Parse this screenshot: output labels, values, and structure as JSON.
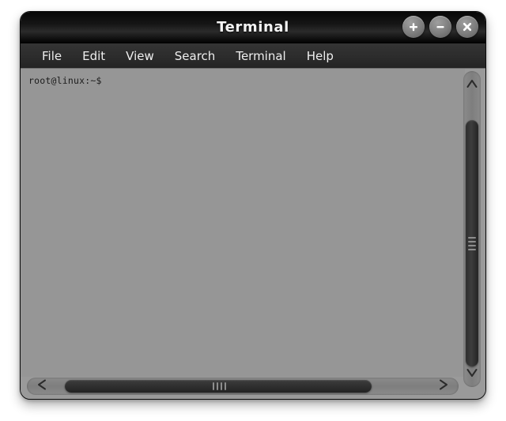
{
  "window": {
    "title": "Terminal",
    "controls": [
      {
        "name": "maximize-button",
        "icon": "plus-icon",
        "label": "+"
      },
      {
        "name": "minimize-button",
        "icon": "minus-icon",
        "label": "−"
      },
      {
        "name": "close-button",
        "icon": "close-icon",
        "label": "×"
      }
    ]
  },
  "menubar": {
    "items": [
      {
        "label": "File"
      },
      {
        "label": "Edit"
      },
      {
        "label": "View"
      },
      {
        "label": "Search"
      },
      {
        "label": "Terminal"
      },
      {
        "label": "Help"
      }
    ]
  },
  "terminal": {
    "prompt": "root@linux:~$",
    "lines": [
      "root@linux:~$"
    ],
    "background_color": "#969696",
    "text_color": "#1c1c1c"
  },
  "scrollbars": {
    "vertical": {
      "up_arrow_icon": "chevron-up-icon",
      "down_arrow_icon": "chevron-down-icon",
      "grip_line_count": 4
    },
    "horizontal": {
      "left_arrow_icon": "chevron-left-icon",
      "right_arrow_icon": "chevron-right-icon",
      "grip_line_count": 4
    }
  },
  "colors": {
    "titlebar": "#0a0a0a",
    "menubar": "#2c2c2c",
    "window_frame": "#9a9a9a",
    "terminal_bg": "#969696",
    "scrollbar_track": "#828282",
    "scrollbar_thumb": "#303030",
    "text_light": "#efefef"
  }
}
